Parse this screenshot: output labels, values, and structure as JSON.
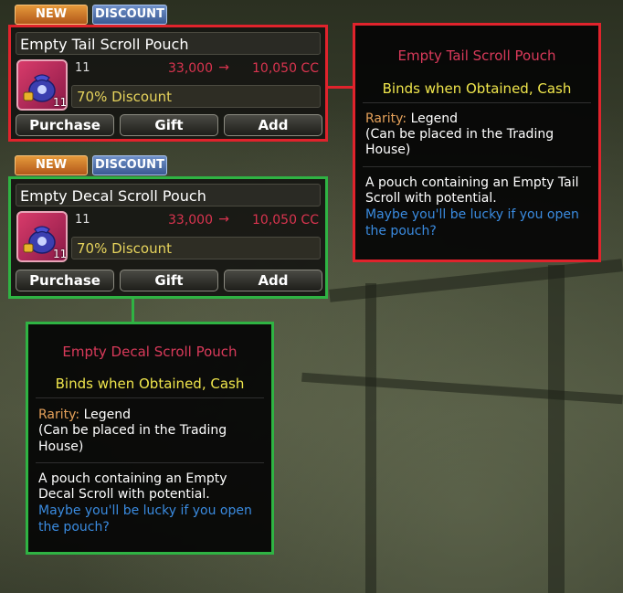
{
  "colors": {
    "red_frame": "#e0232c",
    "green_frame": "#2fb343",
    "price": "#d9344f",
    "discount": "#e6d35c",
    "title": "#d93a5a",
    "binds": "#f0e64c",
    "rarity_label": "#e5a15a",
    "hint": "#3a8be0"
  },
  "items": [
    {
      "tags": {
        "new": "NEW",
        "discount": "DISCOUNT"
      },
      "name": "Empty Tail Scroll Pouch",
      "icon": "pouch-icon",
      "badge_qty": "11",
      "qty": "11",
      "price_old": "33,000",
      "arrow": "→",
      "price_new": "10,050 CC",
      "discount": "70% Discount",
      "buttons": {
        "purchase": "Purchase",
        "gift": "Gift",
        "add": "Add"
      },
      "tooltip": {
        "title": "Empty Tail Scroll Pouch",
        "binds": "Binds when Obtained, Cash",
        "rarity_label": "Rarity:",
        "rarity_value": "Legend",
        "trade_line1": "(Can be placed in the Trading",
        "trade_line2": "House)",
        "desc_line1": "A pouch containing an Empty Tail",
        "desc_line2": "Scroll with potential.",
        "hint_line1": "Maybe you'll be lucky if you open",
        "hint_line2": "the pouch?"
      }
    },
    {
      "tags": {
        "new": "NEW",
        "discount": "DISCOUNT"
      },
      "name": "Empty Decal Scroll Pouch",
      "icon": "pouch-icon",
      "badge_qty": "11",
      "qty": "11",
      "price_old": "33,000",
      "arrow": "→",
      "price_new": "10,050 CC",
      "discount": "70% Discount",
      "buttons": {
        "purchase": "Purchase",
        "gift": "Gift",
        "add": "Add"
      },
      "tooltip": {
        "title": "Empty Decal Scroll Pouch",
        "binds": "Binds when Obtained, Cash",
        "rarity_label": "Rarity:",
        "rarity_value": "Legend",
        "trade_line1": "(Can be placed in the Trading",
        "trade_line2": "House)",
        "desc_line1": "A pouch containing an Empty",
        "desc_line2": "Decal Scroll with potential.",
        "hint_line1": "Maybe you'll be lucky if you open",
        "hint_line2": "the pouch?"
      }
    }
  ]
}
